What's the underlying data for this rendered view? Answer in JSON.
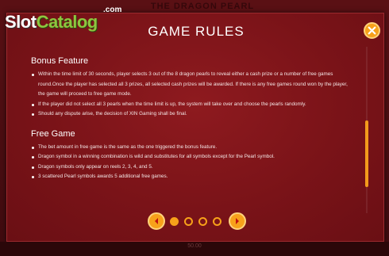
{
  "watermark": {
    "dot_com": ".com",
    "slot": "Slot",
    "catalog": "Catalog"
  },
  "game_title": "THE DRAGON PEARL",
  "panel": {
    "title": "GAME RULES",
    "close_icon": "close-icon",
    "sections": [
      {
        "heading": "Bonus Feature",
        "items": [
          "Within the time limit of 30 seconds, player selects 3 out of the 8 dragon pearls to reveal either a cash prize or a number of free games round.Once the player has selected all 3 prizes, all selected cash prizes will be awarded. If there is any free games round won by the player, the game will proceed to free game mode.",
          "If the player did not select all 3 pearls when the time limit is up, the system will take over and choose the pearls randomly.",
          "Should any dispute arise, the decision of XIN Gaming shall be final."
        ]
      },
      {
        "heading": "Free Game",
        "items": [
          "The bet amount in free game is the same as the one triggered the bonus feature.",
          "Dragon symbol in a winning combination is wild and substitutes for all symbols except for the Pearl symbol.",
          "Dragon symbols only appear on reels 2, 3, 4, and 5.",
          "3 scattered Pearl symbols awards 5 additional free games."
        ]
      }
    ]
  },
  "pager": {
    "page_count": 4,
    "current_page": 1,
    "prev_icon": "chevron-left-icon",
    "next_icon": "chevron-right-icon"
  },
  "bottom_bar": {
    "value": "50.00"
  },
  "colors": {
    "panel": "#7a1318",
    "accent": "#f7a11a",
    "watermark_green": "#8dc63f"
  }
}
